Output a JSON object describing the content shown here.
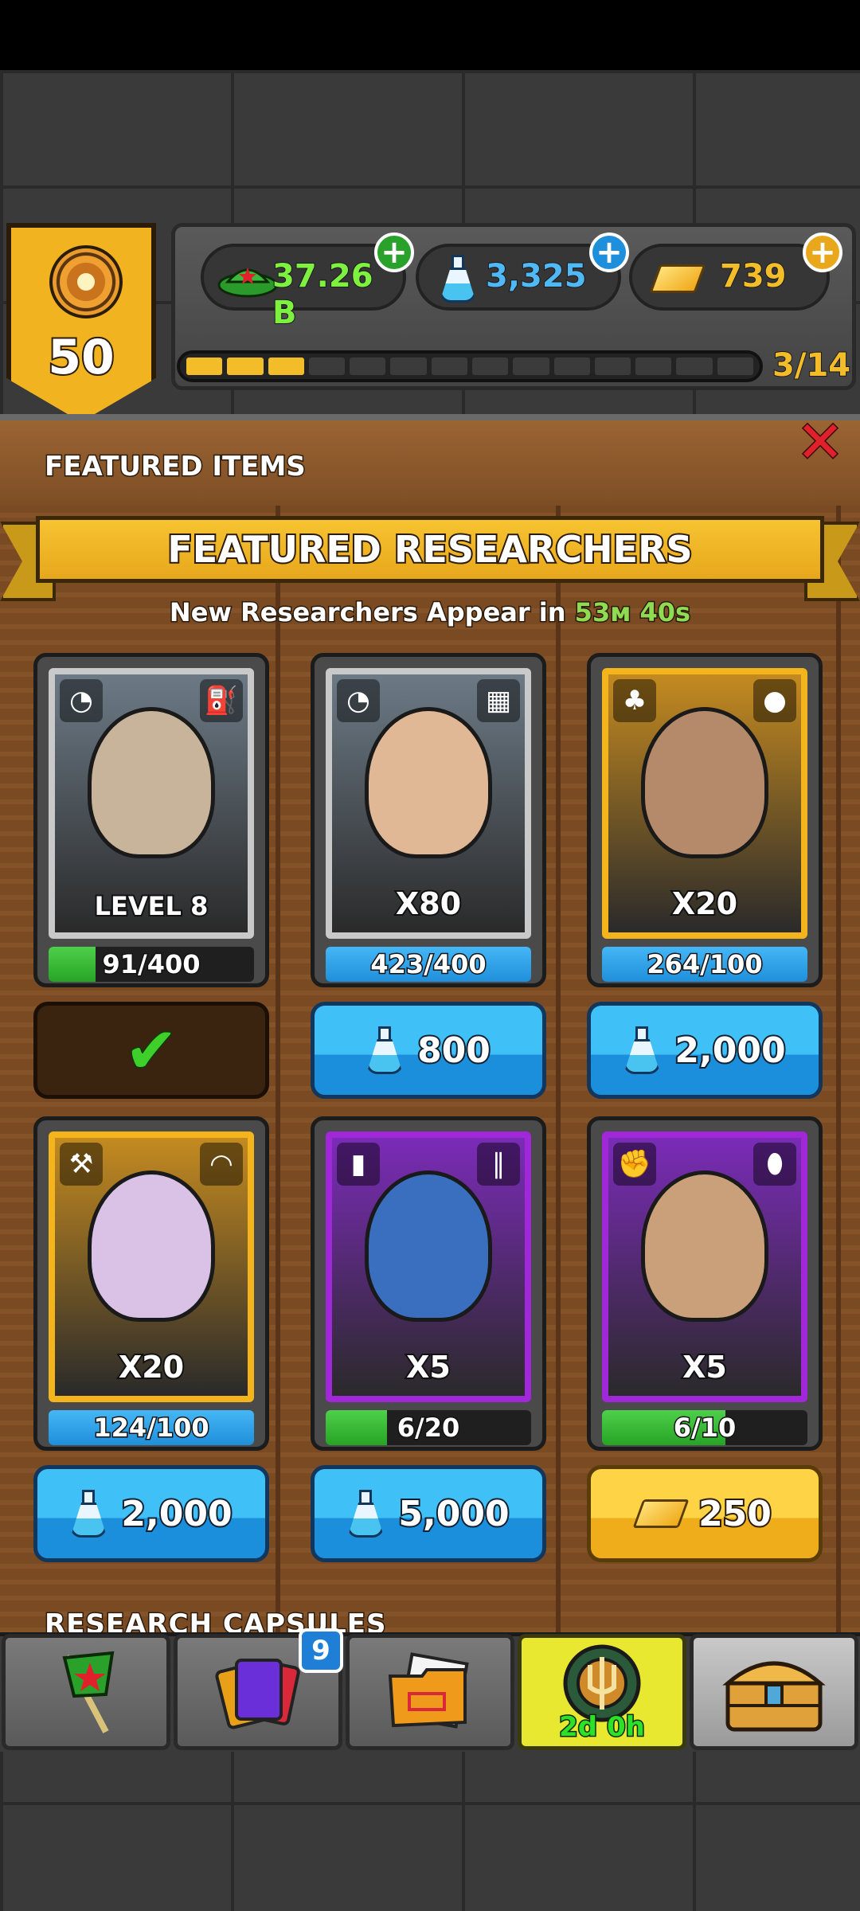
{
  "player": {
    "level": "50"
  },
  "currencies": {
    "cash": {
      "value": "37.26 B",
      "plus": "+"
    },
    "science": {
      "value": "3,325",
      "plus": "+"
    },
    "gold": {
      "value": "739",
      "plus": "+"
    }
  },
  "progress": {
    "text": "3/14",
    "filled": 3,
    "total": 14
  },
  "panel": {
    "section_title": "FEATURED ITEMS",
    "close": "✕",
    "ribbon_title": "FEATURED RESEARCHERS",
    "timer_prefix": "New Researchers Appear in",
    "timer_value": "53м 40s"
  },
  "cards": [
    {
      "label": "LEVEL 8",
      "progress": "91/400",
      "fill": 0.23,
      "fill_color": "green",
      "rarity": "silver",
      "left_icon": "speed-icon",
      "right_icon": "oil-pump-icon",
      "button": {
        "type": "owned",
        "amount": "",
        "currency": "none"
      },
      "face": "#c8b49a"
    },
    {
      "label": "X80",
      "progress": "423/400",
      "fill": 1.0,
      "fill_color": "blue",
      "rarity": "silver",
      "left_icon": "speed-icon",
      "right_icon": "tank-icon",
      "button": {
        "type": "blue",
        "amount": "800",
        "currency": "science"
      },
      "face": "#e0b896"
    },
    {
      "label": "X20",
      "progress": "264/100",
      "fill": 1.0,
      "fill_color": "blue",
      "rarity": "gold",
      "left_icon": "clover-icon",
      "right_icon": "potato-icon",
      "button": {
        "type": "blue",
        "amount": "2,000",
        "currency": "science"
      },
      "face": "#b48a6a"
    },
    {
      "label": "X20",
      "progress": "124/100",
      "fill": 1.0,
      "fill_color": "blue",
      "rarity": "gold",
      "left_icon": "hammer-icon",
      "right_icon": "hat-icon",
      "button": {
        "type": "blue",
        "amount": "2,000",
        "currency": "science"
      },
      "face": "#d9c2e6"
    },
    {
      "label": "X5",
      "progress": "6/20",
      "fill": 0.3,
      "fill_color": "green",
      "rarity": "purple",
      "left_icon": "fire-extinguisher-icon",
      "right_icon": "bullets-icon",
      "button": {
        "type": "blue",
        "amount": "5,000",
        "currency": "science"
      },
      "face": "#3a6fc0"
    },
    {
      "label": "X5",
      "progress": "6/10",
      "fill": 0.6,
      "fill_color": "green",
      "rarity": "purple",
      "left_icon": "muscle-icon",
      "right_icon": "pill-icon",
      "button": {
        "type": "gold",
        "amount": "250",
        "currency": "gold"
      },
      "face": "#c9a07a"
    }
  ],
  "bottom": {
    "section_title": "RESEARCH CAPSULES",
    "nav": [
      {
        "name": "flag-icon",
        "badge": "",
        "timer": ""
      },
      {
        "name": "cards-icon",
        "badge": "9",
        "timer": ""
      },
      {
        "name": "folder-icon",
        "badge": "",
        "timer": ""
      },
      {
        "name": "event-icon",
        "badge": "",
        "timer": "2d 0h"
      },
      {
        "name": "chest-icon",
        "badge": "",
        "timer": ""
      }
    ]
  }
}
